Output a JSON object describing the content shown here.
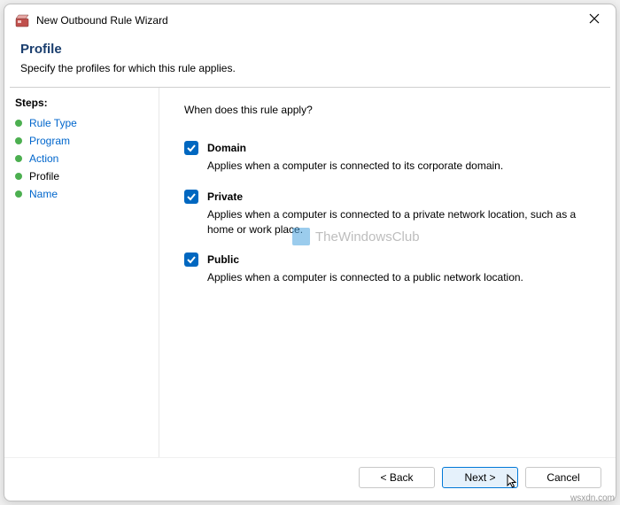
{
  "window": {
    "title": "New Outbound Rule Wizard"
  },
  "header": {
    "title": "Profile",
    "subtitle": "Specify the profiles for which this rule applies."
  },
  "sidebar": {
    "heading": "Steps:",
    "items": [
      {
        "label": "Rule Type",
        "current": false
      },
      {
        "label": "Program",
        "current": false
      },
      {
        "label": "Action",
        "current": false
      },
      {
        "label": "Profile",
        "current": true
      },
      {
        "label": "Name",
        "current": false
      }
    ]
  },
  "content": {
    "question": "When does this rule apply?",
    "options": [
      {
        "label": "Domain",
        "checked": true,
        "desc": "Applies when a computer is connected to its corporate domain."
      },
      {
        "label": "Private",
        "checked": true,
        "desc": "Applies when a computer is connected to a private network location, such as a home or work place."
      },
      {
        "label": "Public",
        "checked": true,
        "desc": "Applies when a computer is connected to a public network location."
      }
    ]
  },
  "watermark": "TheWindowsClub",
  "footer": {
    "back": "< Back",
    "next": "Next >",
    "cancel": "Cancel"
  },
  "credit": "wsxdn.com"
}
